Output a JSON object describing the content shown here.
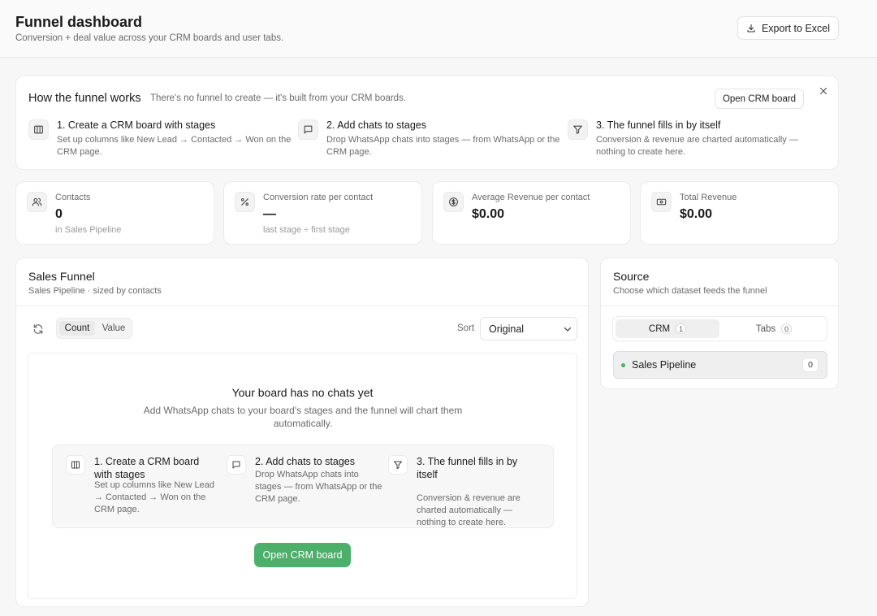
{
  "header": {
    "title": "Funnel dashboard",
    "subtitle": "Conversion + deal value across your CRM boards and user tabs.",
    "export_label": "Export to Excel"
  },
  "how_it_works": {
    "title": "How the funnel works",
    "description": "There's no funnel to create — it's built from your CRM boards.",
    "open_crm_label": "Open CRM board",
    "steps": [
      {
        "title": "1. Create a CRM board with stages",
        "body": "Set up columns like New Lead → Contacted → Won on the CRM page.",
        "icon": "board-columns-icon"
      },
      {
        "title": "2. Add chats to stages",
        "body": "Drop WhatsApp chats into stages — from WhatsApp or the CRM page.",
        "icon": "chat-bubble-icon"
      },
      {
        "title": "3. The funnel fills in by itself",
        "body": "Conversion & revenue are charted automatically — nothing to create here.",
        "icon": "funnel-icon"
      }
    ]
  },
  "stats": [
    {
      "label": "Contacts",
      "value": "0",
      "sub": "in Sales Pipeline",
      "icon": "users-icon"
    },
    {
      "label": "Conversion rate per contact",
      "value": "—",
      "sub": "last stage ÷ first stage",
      "icon": "percent-icon"
    },
    {
      "label": "Average Revenue per contact",
      "value": "$0.00",
      "sub": "",
      "icon": "dollar-circle-icon"
    },
    {
      "label": "Total Revenue",
      "value": "$0.00",
      "sub": "",
      "icon": "banknote-icon"
    }
  ],
  "sales_funnel": {
    "title": "Sales Funnel",
    "subtitle": "Sales Pipeline · sized by contacts",
    "toggle": {
      "count_label": "Count",
      "value_label": "Value",
      "selected": "Count"
    },
    "sort_label": "Sort",
    "sort_value": "Original",
    "empty": {
      "title": "Your board has no chats yet",
      "description": "Add WhatsApp chats to your board's stages and the funnel will chart them automatically.",
      "steps": [
        {
          "title": "1. Create a CRM board with stages",
          "body": "Set up columns like New Lead → Contacted → Won on the CRM page."
        },
        {
          "title": "2. Add chats to stages",
          "body": "Drop WhatsApp chats into stages — from WhatsApp or the CRM page."
        },
        {
          "title": "3. The funnel fills in by itself",
          "body": "Conversion & revenue are charted automatically — nothing to create here."
        }
      ],
      "cta_label": "Open CRM board"
    }
  },
  "source": {
    "title": "Source",
    "subtitle": "Choose which dataset feeds the funnel",
    "tabs": [
      {
        "label": "CRM",
        "count": "1",
        "selected": true
      },
      {
        "label": "Tabs",
        "count": "0",
        "selected": false
      }
    ],
    "items": [
      {
        "label": "Sales Pipeline",
        "count": "0"
      }
    ]
  },
  "colors": {
    "accent_green": "#4caf6a",
    "text_primary": "#1a1a1a",
    "text_muted": "#6b6b6b"
  }
}
